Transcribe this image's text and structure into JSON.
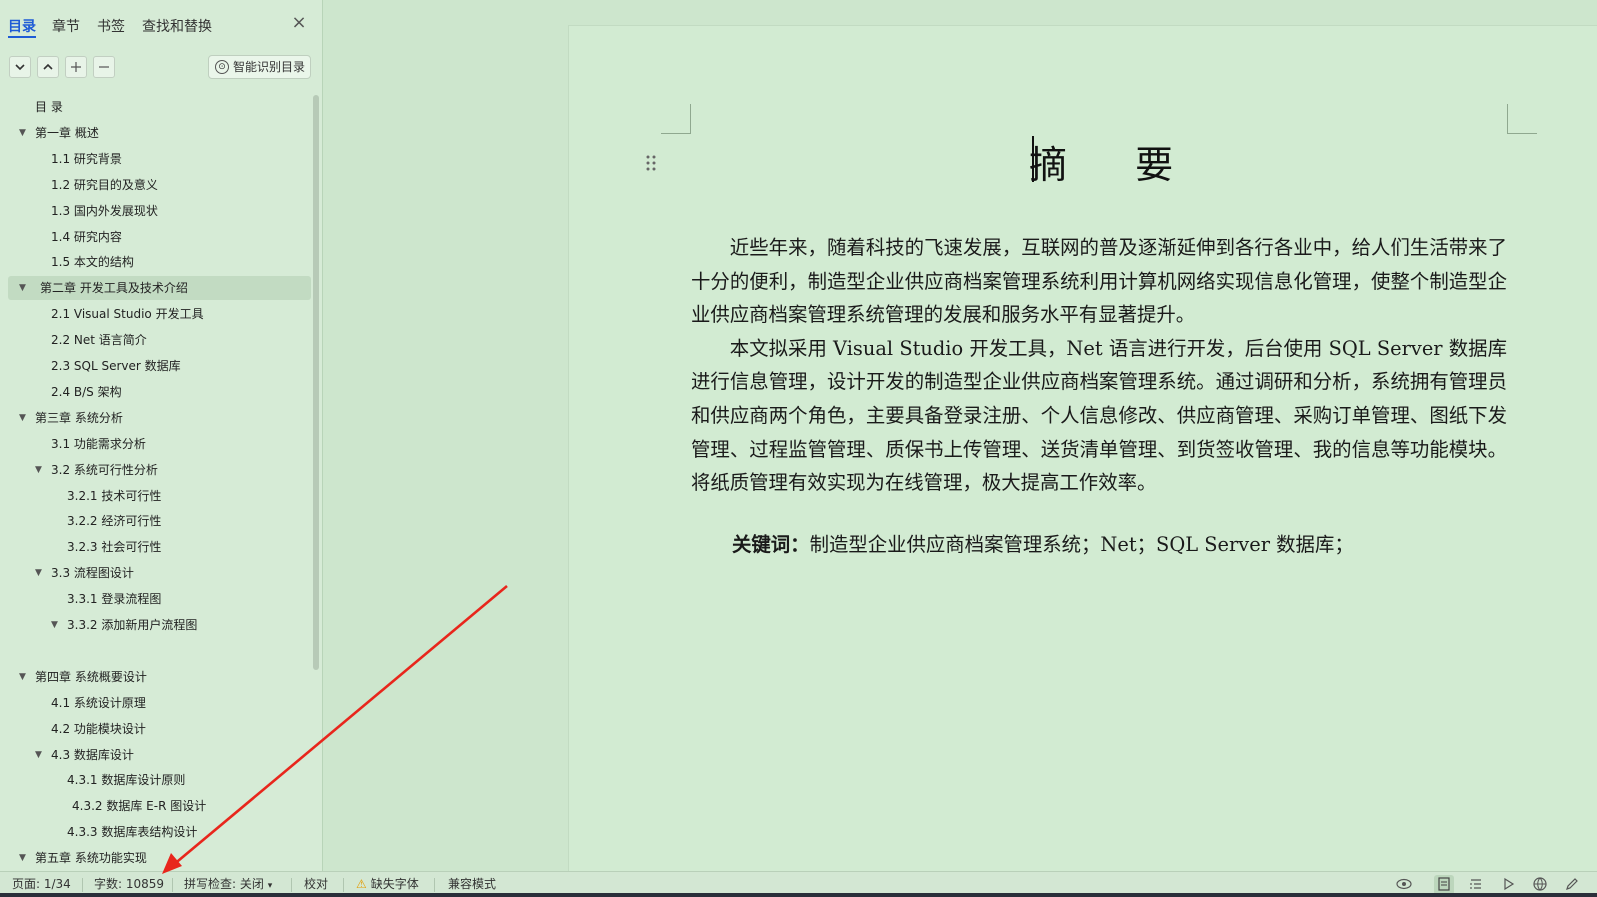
{
  "sidebar": {
    "tabs": [
      {
        "label": "目录",
        "active": true
      },
      {
        "label": "章节"
      },
      {
        "label": "书签"
      },
      {
        "label": "查找和替换"
      }
    ],
    "close_label": "×",
    "toolbar": {
      "expand_icon": "chevron-down-icon",
      "collapse_icon": "chevron-up-icon",
      "add_icon": "plus-icon",
      "remove_icon": "minus-icon",
      "smart_label": "智能识别目录"
    },
    "toc": [
      {
        "level": 0,
        "text": "目   录"
      },
      {
        "level": 0,
        "text": "第一章  概述",
        "expanded": true
      },
      {
        "level": 1,
        "text": "1.1  研究背景"
      },
      {
        "level": 1,
        "text": "1.2 研究目的及意义"
      },
      {
        "level": 1,
        "text": "1.3 国内外发展现状"
      },
      {
        "level": 1,
        "text": "1.4  研究内容"
      },
      {
        "level": 1,
        "text": "1.5 本文的结构"
      },
      {
        "level": 0,
        "text": "第二章  开发工具及技术介绍",
        "expanded": true,
        "selected": true
      },
      {
        "level": 1,
        "text": "2.1 Visual Studio 开发工具"
      },
      {
        "level": 1,
        "text": "2.2 Net 语言简介"
      },
      {
        "level": 1,
        "text": "2.3 SQL Server 数据库"
      },
      {
        "level": 1,
        "text": "2.4 B/S 架构"
      },
      {
        "level": 0,
        "text": "第三章  系统分析",
        "expanded": true
      },
      {
        "level": 1,
        "text": "3.1 功能需求分析"
      },
      {
        "level": 1,
        "text": "3.2 系统可行性分析",
        "expanded": true
      },
      {
        "level": 2,
        "text": "3.2.1 技术可行性"
      },
      {
        "level": 2,
        "text": "3.2.2  经济可行性"
      },
      {
        "level": 2,
        "text": "3.2.3 社会可行性"
      },
      {
        "level": 1,
        "text": "3.3 流程图设计",
        "expanded": true
      },
      {
        "level": 2,
        "text": "3.3.1  登录流程图"
      },
      {
        "level": 2,
        "text": "3.3.2  添加新用户流程图",
        "expanded": true
      },
      {
        "level": -1,
        "text": ""
      },
      {
        "level": 0,
        "text": "第四章  系统概要设计",
        "expanded": true
      },
      {
        "level": 1,
        "text": "4.1 系统设计原理"
      },
      {
        "level": 1,
        "text": "4.2 功能模块设计"
      },
      {
        "level": 1,
        "text": "4.3  数据库设计",
        "expanded": true
      },
      {
        "level": 2,
        "text": "4.3.1 数据库设计原则"
      },
      {
        "level": 2,
        "text": "4.3.2 数据库 E-R 图设计",
        "extra_indent": true
      },
      {
        "level": 2,
        "text": "4.3.3 数据库表结构设计"
      },
      {
        "level": 0,
        "text": "第五章  系统功能实现",
        "expanded": true
      }
    ]
  },
  "document": {
    "title": "摘 要",
    "paragraphs": [
      "近些年来，随着科技的飞速发展，互联网的普及逐渐延伸到各行各业中，给人们生活带来了十分的便利，制造型企业供应商档案管理系统利用计算机网络实现信息化管理，使整个制造型企业供应商档案管理系统管理的发展和服务水平有显著提升。",
      "本文拟采用 Visual Studio 开发工具，Net 语言进行开发，后台使用 SQL Server 数据库进行信息管理，设计开发的制造型企业供应商档案管理系统。通过调研和分析，系统拥有管理员和供应商两个角色，主要具备登录注册、个人信息修改、供应商管理、采购订单管理、图纸下发管理、过程监管管理、质保书上传管理、送货清单管理、到货签收管理、我的信息等功能模块。将纸质管理有效实现为在线管理，极大提高工作效率。"
    ],
    "keywords_label": "关键词：",
    "keywords": "制造型企业供应商档案管理系统；Net；SQL Server 数据库；"
  },
  "statusbar": {
    "page": "页面: 1/34",
    "words": "字数: 10859",
    "spell": "拼写检查: 关闭",
    "proofread": "校对",
    "missing_font": "缺失字体",
    "compat": "兼容模式"
  },
  "colors": {
    "accent": "#1e5bd6",
    "annotation_arrow": "#e8261c",
    "background": "#cfe8cf"
  }
}
